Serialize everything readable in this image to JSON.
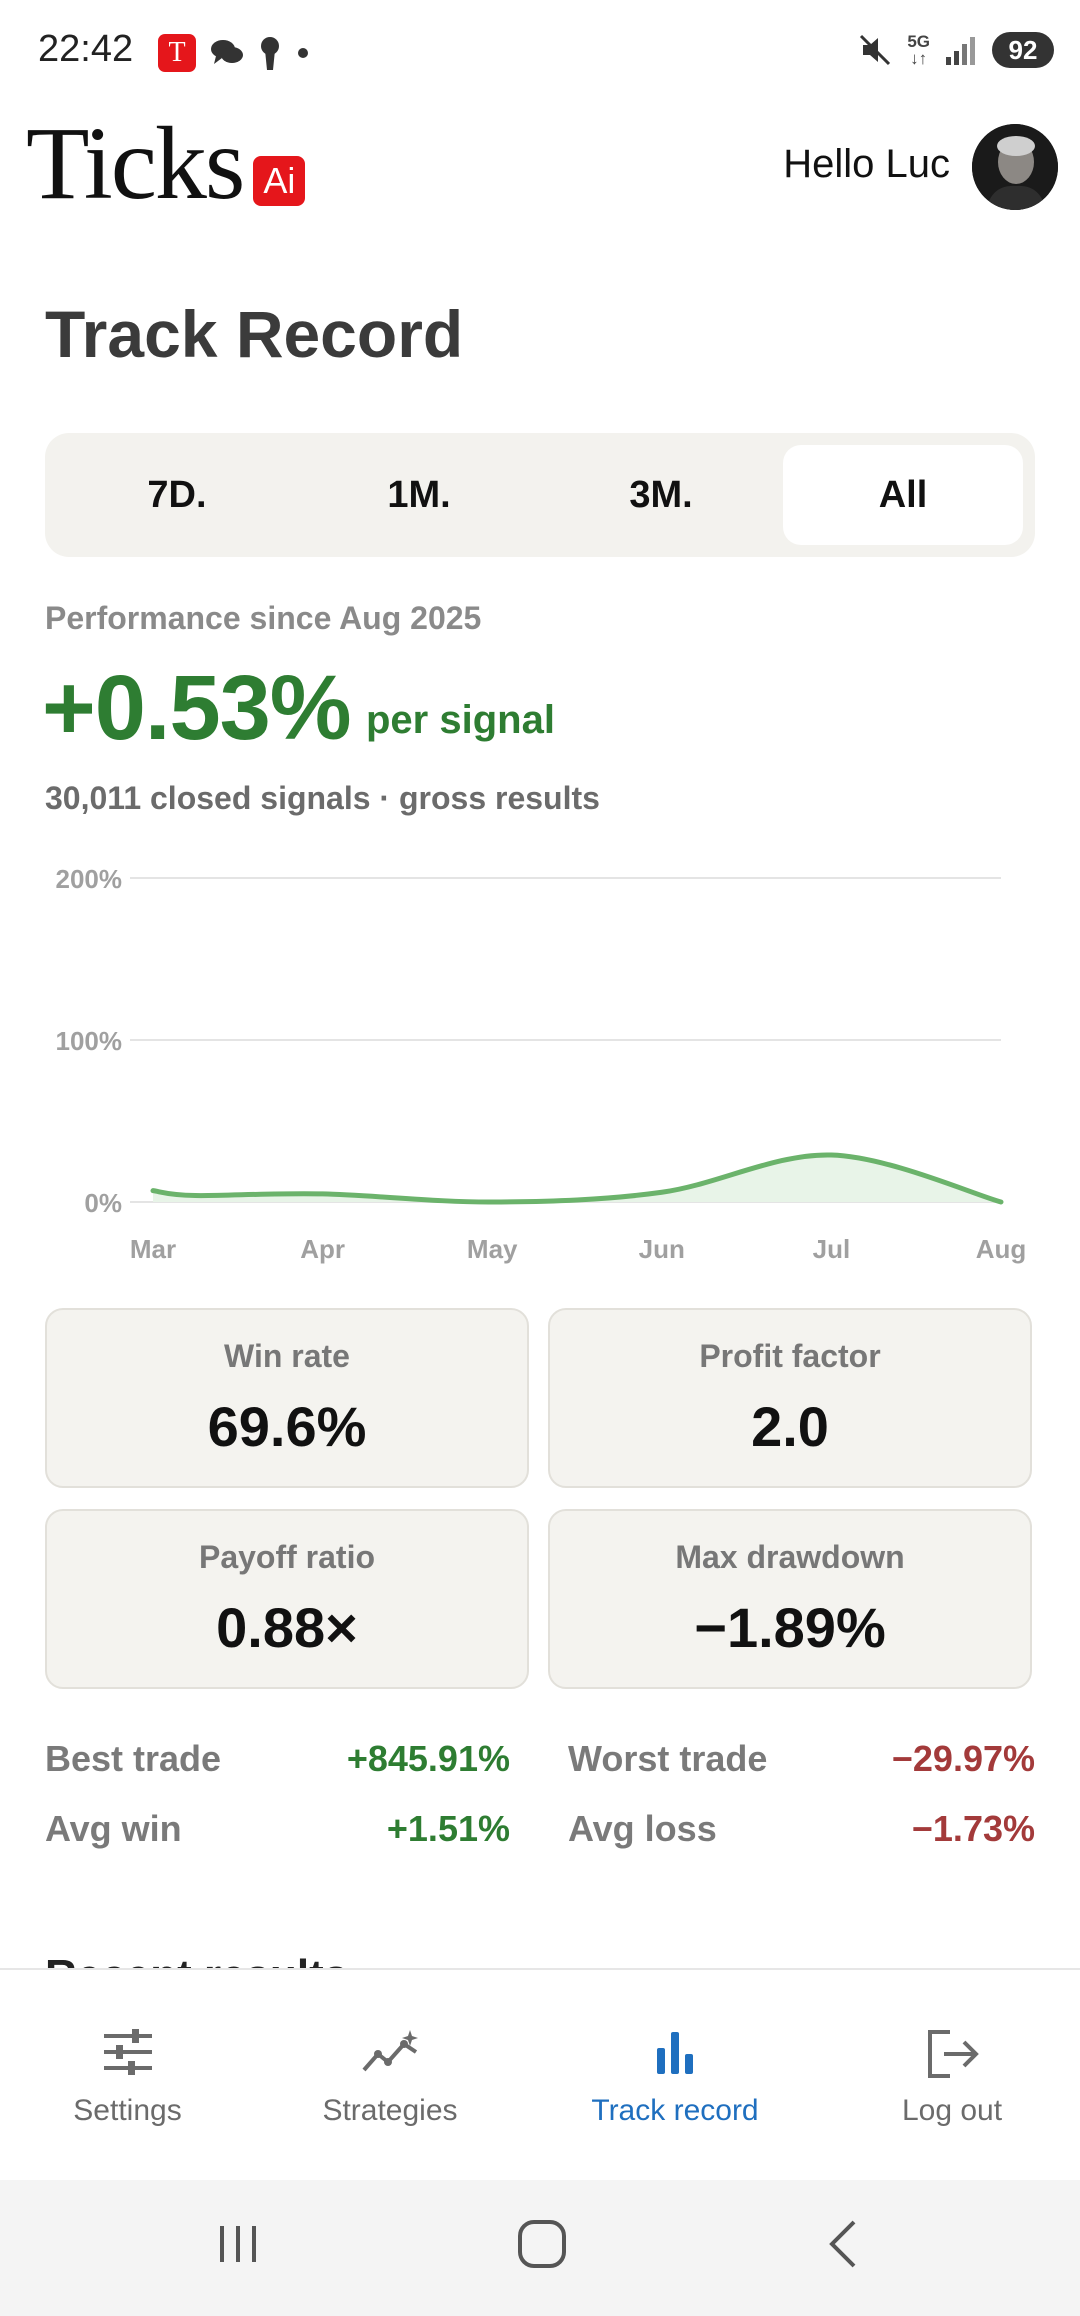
{
  "status_bar": {
    "time": "22:42",
    "app_icon_letter": "T",
    "battery": "92",
    "network": "5G"
  },
  "header": {
    "logo_text": "Ticks",
    "logo_badge": "Ai",
    "greeting": "Hello Luc"
  },
  "page_title": "Track Record",
  "range_tabs": [
    {
      "label": "7D.",
      "active": false
    },
    {
      "label": "1M.",
      "active": false
    },
    {
      "label": "3M.",
      "active": false
    },
    {
      "label": "All",
      "active": true
    }
  ],
  "performance": {
    "since": "Performance since Aug 2025",
    "value": "+0.53%",
    "unit": "per signal",
    "subtitle": "30,011 closed signals · gross results"
  },
  "chart_data": {
    "type": "area",
    "categories": [
      "Mar",
      "Apr",
      "May",
      "Jun",
      "Jul",
      "Aug"
    ],
    "y_tick_labels": [
      "200%",
      "100%",
      "0%"
    ],
    "ylim": [
      0,
      200
    ],
    "series": [
      {
        "x": [
          0,
          0.25,
          1,
          2,
          3,
          4,
          5
        ],
        "values": [
          7,
          4,
          5,
          0,
          6,
          29,
          0
        ]
      }
    ],
    "line_color": "#6bb36b",
    "fill_color": "#e8f4e8",
    "grid": true
  },
  "metrics": [
    {
      "label": "Win rate",
      "value": "69.6%"
    },
    {
      "label": "Profit factor",
      "value": "2.0"
    },
    {
      "label": "Payoff ratio",
      "value": "0.88×"
    },
    {
      "label": "Max drawdown",
      "value": "−1.89%"
    }
  ],
  "stats": {
    "best_trade": {
      "label": "Best trade",
      "value": "+845.91%"
    },
    "worst_trade": {
      "label": "Worst trade",
      "value": "−29.97%"
    },
    "avg_win": {
      "label": "Avg win",
      "value": "+1.51%"
    },
    "avg_loss": {
      "label": "Avg loss",
      "value": "−1.73%"
    }
  },
  "section_peek": "Recent results",
  "bottom_nav": [
    {
      "label": "Settings",
      "icon": "sliders-icon",
      "active": false
    },
    {
      "label": "Strategies",
      "icon": "strategies-icon",
      "active": false
    },
    {
      "label": "Track record",
      "icon": "bar-chart-icon",
      "active": true
    },
    {
      "label": "Log out",
      "icon": "logout-icon",
      "active": false
    }
  ],
  "colors": {
    "positive": "#2e7d32",
    "negative": "#a33a3a",
    "active_nav": "#1f6fbf",
    "brand_red": "#e5161b"
  }
}
